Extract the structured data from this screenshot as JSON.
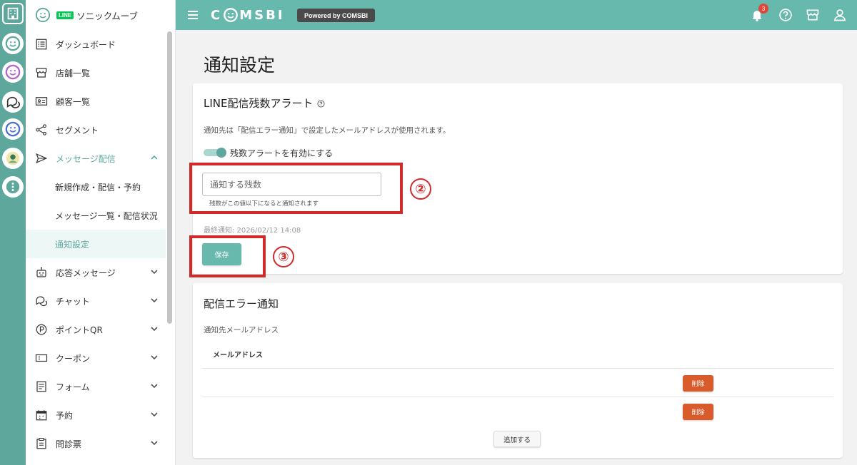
{
  "colors": {
    "brand": "#67b8ad",
    "rail": "#5ea79d",
    "danger": "#d95b2b",
    "annotation": "#d12a2a",
    "line": "#06c755"
  },
  "sidebar": {
    "account_badge": "LINE",
    "account_name": "ソニックムーブ",
    "items": [
      {
        "label": "ダッシュボード",
        "icon": "list-icon"
      },
      {
        "label": "店舗一覧",
        "icon": "store-icon"
      },
      {
        "label": "顧客一覧",
        "icon": "id-card-icon"
      },
      {
        "label": "セグメント",
        "icon": "share-icon"
      },
      {
        "label": "メッセージ配信",
        "icon": "send-icon"
      },
      {
        "label": "応答メッセージ",
        "icon": "robot-icon"
      },
      {
        "label": "チャット",
        "icon": "chat-icon"
      },
      {
        "label": "ポイントQR",
        "icon": "point-icon"
      },
      {
        "label": "クーポン",
        "icon": "coupon-icon"
      },
      {
        "label": "フォーム",
        "icon": "form-icon"
      },
      {
        "label": "予約",
        "icon": "calendar-icon"
      },
      {
        "label": "問診票",
        "icon": "clipboard-icon"
      }
    ],
    "sub_items": [
      {
        "label": "新規作成・配信・予約"
      },
      {
        "label": "メッセージ一覧・配信状況"
      },
      {
        "label": "通知設定"
      }
    ]
  },
  "header": {
    "logo_left": "C",
    "logo_right": "MSBI",
    "powered": "Powered by COMSBI",
    "notification_count": "3"
  },
  "page": {
    "title": "通知設定"
  },
  "alert_card": {
    "title": "LINE配信残数アラート",
    "description": "通知先は「配信エラー通知」で設定したメールアドレスが使用されます。",
    "toggle_label": "残数アラートを有効にする",
    "toggle_on": true,
    "input_placeholder": "通知する残数",
    "input_value": "",
    "hint": "残数がこの値以下になると通知されます",
    "last_notification": "最終通知: 2026/02/12 14:08",
    "save_label": "保存"
  },
  "error_card": {
    "title": "配信エラー通知",
    "subtitle": "通知先メールアドレス",
    "column_header": "メールアドレス",
    "rows": [
      {
        "email": "",
        "delete_label": "削除"
      },
      {
        "email": "",
        "delete_label": "削除"
      }
    ],
    "add_label": "追加する"
  },
  "annotations": [
    {
      "number": "②"
    },
    {
      "number": "③"
    }
  ]
}
